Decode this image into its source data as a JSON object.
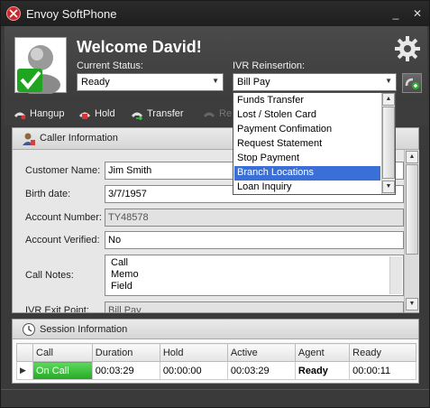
{
  "window": {
    "title": "Envoy SoftPhone",
    "minimize": "_",
    "close": "✕"
  },
  "header": {
    "welcome": "Welcome David!",
    "status_label": "Current Status:",
    "status_value": "Ready",
    "ivr_label": "IVR Reinsertion:",
    "ivr_value": "Bill Pay"
  },
  "toolbar": {
    "hangup": "Hangup",
    "hold": "Hold",
    "transfer": "Transfer",
    "fourth_partial": "Re"
  },
  "caller_panel": {
    "title": "Caller Information",
    "fields": {
      "customer_name_label": "Customer Name:",
      "customer_name": "Jim Smith",
      "birth_date_label": "Birth date:",
      "birth_date": "3/7/1957",
      "account_number_label": "Account Number:",
      "account_number": "TY48578",
      "account_verified_label": "Account Verified:",
      "account_verified": "No",
      "call_notes_label": "Call Notes:",
      "call_notes_lines": [
        "Call",
        "Memo",
        "Field"
      ],
      "ivr_exit_label": "IVR Exit Point:",
      "ivr_exit_value": "Bill Pay"
    }
  },
  "ivr_dropdown": {
    "items": [
      "Funds Transfer",
      "Lost / Stolen Card",
      "Payment Confimation",
      "Request Statement",
      "Stop Payment",
      "Branch Locations",
      "Loan Inquiry"
    ],
    "highlighted": "Branch Locations"
  },
  "session": {
    "title": "Session Information",
    "columns": [
      "Call",
      "Duration",
      "Hold",
      "Active",
      "Agent",
      "Ready"
    ],
    "row": {
      "marker": "▶",
      "call": "On Call",
      "duration": "00:03:29",
      "hold": "00:00:00",
      "active": "00:03:29",
      "agent": "Ready",
      "ready": "00:00:11"
    }
  },
  "colors": {
    "accent_green": "#25a825",
    "highlight_blue": "#3a6fd8",
    "titlebar": "#1e1e1e"
  }
}
